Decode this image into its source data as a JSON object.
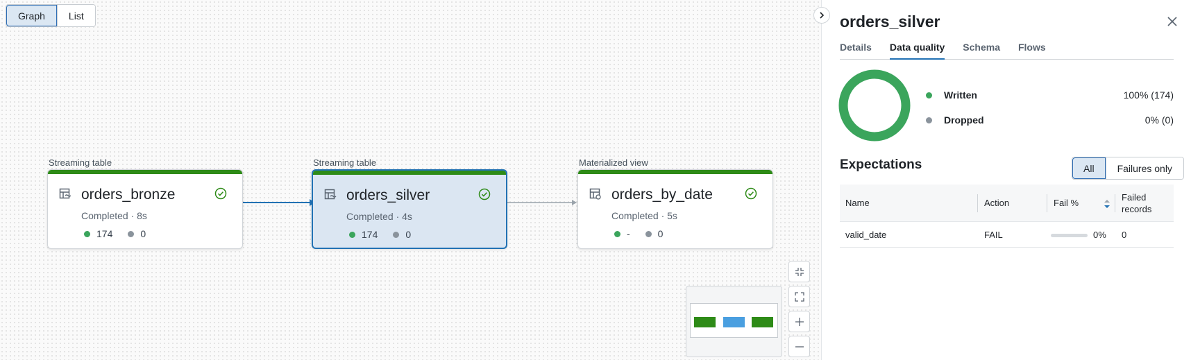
{
  "view_toggle": {
    "graph": "Graph",
    "list": "List"
  },
  "nodes": [
    {
      "type": "Streaming table",
      "name": "orders_bronze",
      "status": "Completed · 8s",
      "written": "174",
      "dropped": "0"
    },
    {
      "type": "Streaming table",
      "name": "orders_silver",
      "status": "Completed · 4s",
      "written": "174",
      "dropped": "0"
    },
    {
      "type": "Materialized view",
      "name": "orders_by_date",
      "status": "Completed · 5s",
      "written": "-",
      "dropped": "0"
    }
  ],
  "panel": {
    "title": "orders_silver",
    "tabs": [
      "Details",
      "Data quality",
      "Schema",
      "Flows"
    ],
    "active_tab": "Data quality",
    "quality": {
      "written_label": "Written",
      "written_value": "100% (174)",
      "written_fraction": 1.0,
      "dropped_label": "Dropped",
      "dropped_value": "0% (0)"
    },
    "expectations": {
      "title": "Expectations",
      "filter_all": "All",
      "filter_failures": "Failures only",
      "columns": {
        "name": "Name",
        "action": "Action",
        "fail_pct": "Fail %",
        "failed_records": "Failed records"
      },
      "rows": [
        {
          "name": "valid_date",
          "action": "FAIL",
          "fail_pct": "0%",
          "fail_fraction": 0,
          "failed_records": "0"
        }
      ]
    }
  },
  "colors": {
    "success": "#2e8b17",
    "selected": "#2272b4",
    "donut": "#3ba55c",
    "minimap_selected": "#4a9fe0"
  }
}
